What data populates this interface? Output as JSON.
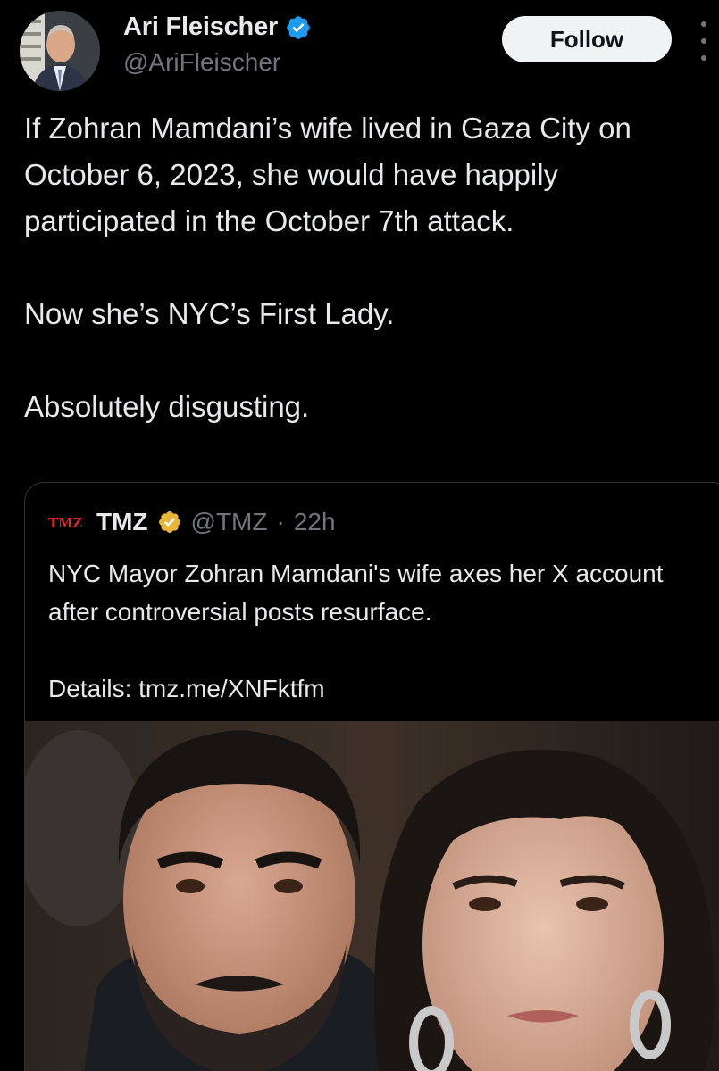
{
  "author": {
    "display_name": "Ari Fleischer",
    "handle": "@AriFleischer",
    "avatar_icon": "profile-photo",
    "verified_color": "#1d9bf0"
  },
  "actions": {
    "follow_label": "Follow",
    "more_icon": "more-vertical-icon"
  },
  "tweet": {
    "paragraphs": [
      "If Zohran Mamdani’s wife lived in Gaza City on October 6, 2023, she would have happily participated in the October 7th attack.",
      "Now she’s NYC’s First Lady.",
      "Absolutely disgusting."
    ]
  },
  "quote": {
    "logo_text": "TMZ",
    "display_name": "TMZ",
    "handle": "@TMZ",
    "separator": "·",
    "time": "22h",
    "verified_color": "#e8b53a",
    "text_lines": [
      "NYC Mayor Zohran Mamdani's wife axes her X account after controversial posts resurface.",
      "Details: tmz.me/XNFktfm"
    ],
    "media_icon": "photo-of-two-people"
  },
  "colors": {
    "background": "#000000",
    "text_primary": "#e7e9ea",
    "text_secondary": "#71767b",
    "border": "#2f3336",
    "follow_bg": "#eff3f4"
  }
}
